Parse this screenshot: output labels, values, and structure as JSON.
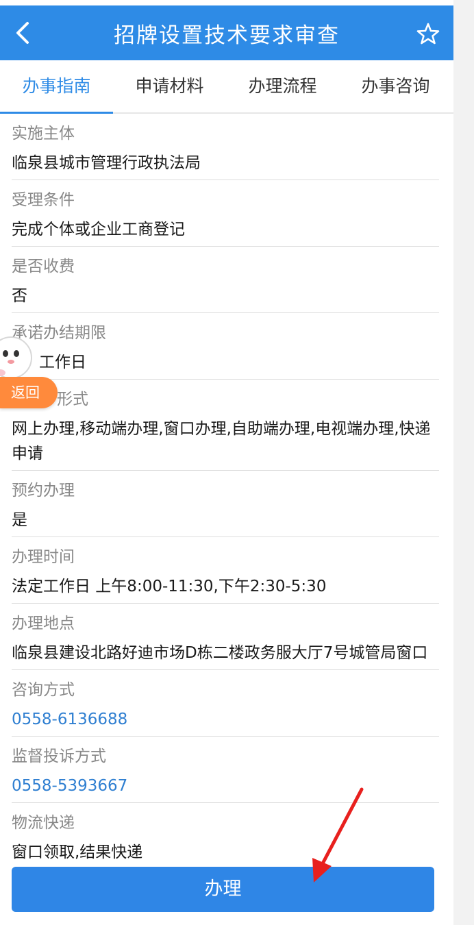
{
  "header": {
    "title": "招牌设置技术要求审查",
    "back_icon": "chevron-left-icon",
    "favorite_icon": "star-outline-icon"
  },
  "tabs": [
    {
      "label": "办事指南",
      "active": true
    },
    {
      "label": "申请材料",
      "active": false
    },
    {
      "label": "办理流程",
      "active": false
    },
    {
      "label": "办事咨询",
      "active": false
    }
  ],
  "sections": [
    {
      "label": "实施主体",
      "value": "临泉县城市管理行政执法局"
    },
    {
      "label": "受理条件",
      "value": "完成个体或企业工商登记"
    },
    {
      "label": "是否收费",
      "value": "否"
    },
    {
      "label": "承诺办结期限",
      "value": "工作日"
    },
    {
      "label": "形式",
      "value": "网上办理,移动端办理,窗口办理,自助端办理,电视端办理,快递申请"
    },
    {
      "label": "预约办理",
      "value": "是"
    },
    {
      "label": "办理时间",
      "value": "法定工作日 上午8:00-11:30,下午2:30-5:30"
    },
    {
      "label": "办理地点",
      "value": "临泉县建设北路好迪市场D栋二楼政务服大厅7号城管局窗口"
    },
    {
      "label": "咨询方式",
      "value": "0558-6136688",
      "link": true
    },
    {
      "label": "监督投诉方式",
      "value": "0558-5393667",
      "link": true
    },
    {
      "label": "物流快递",
      "value": "窗口领取,结果快递"
    }
  ],
  "floating": {
    "back_label": "返回"
  },
  "action": {
    "handle_label": "办理"
  },
  "colors": {
    "primary": "#2e8be6",
    "link": "#2f7fd1",
    "float_button": "#ff8a3c",
    "annotation_arrow": "#e8201e"
  }
}
